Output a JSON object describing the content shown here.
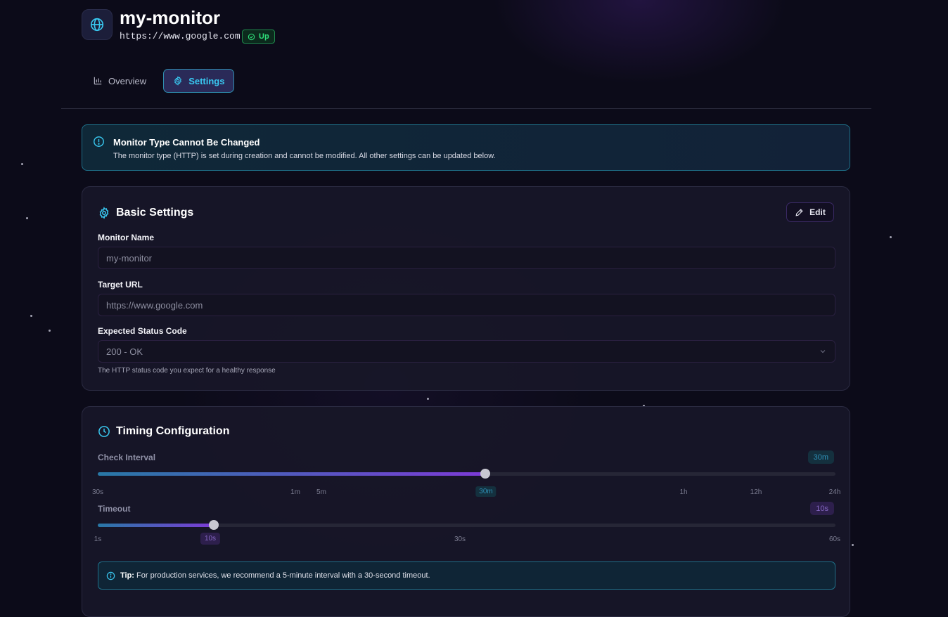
{
  "monitor": {
    "name": "my-monitor",
    "url": "https://www.google.com",
    "status": "Up",
    "icon": "globe-icon"
  },
  "tabs": [
    {
      "label": "Overview",
      "icon": "bar-chart-icon",
      "active": false
    },
    {
      "label": "Settings",
      "icon": "gear-icon",
      "active": true
    }
  ],
  "alert": {
    "title": "Monitor Type Cannot Be Changed",
    "text": "The monitor type (HTTP) is set during creation and cannot be modified. All other settings can be updated below.",
    "icon": "info-icon"
  },
  "basic_settings": {
    "title": "Basic Settings",
    "edit_label": "Edit",
    "monitor_name_label": "Monitor Name",
    "monitor_name_value": "my-monitor",
    "target_url_label": "Target URL",
    "target_url_value": "https://www.google.com",
    "status_code_label": "Expected Status Code",
    "status_code_value": "200 - OK",
    "status_code_hint": "The HTTP status code you expect for a healthy response"
  },
  "timing": {
    "title": "Timing Configuration",
    "check_interval": {
      "label": "Check Interval",
      "value": "30m",
      "fraction": 0.525,
      "ticks": [
        "30s",
        "1m",
        "5m",
        "30m",
        "1h",
        "12h",
        "24h"
      ]
    },
    "timeout": {
      "label": "Timeout",
      "value": "10s",
      "fraction": 0.157,
      "ticks": [
        "1s",
        "10s",
        "30s",
        "60s"
      ]
    },
    "tip_prefix": "Tip:",
    "tip_text": "For production services, we recommend a 5-minute interval with a 30-second timeout."
  },
  "colors": {
    "accent_cyan": "#39c8f0",
    "accent_purple": "#7c3bd6",
    "status_up": "#2fe07a",
    "background": "#0c0b19"
  }
}
